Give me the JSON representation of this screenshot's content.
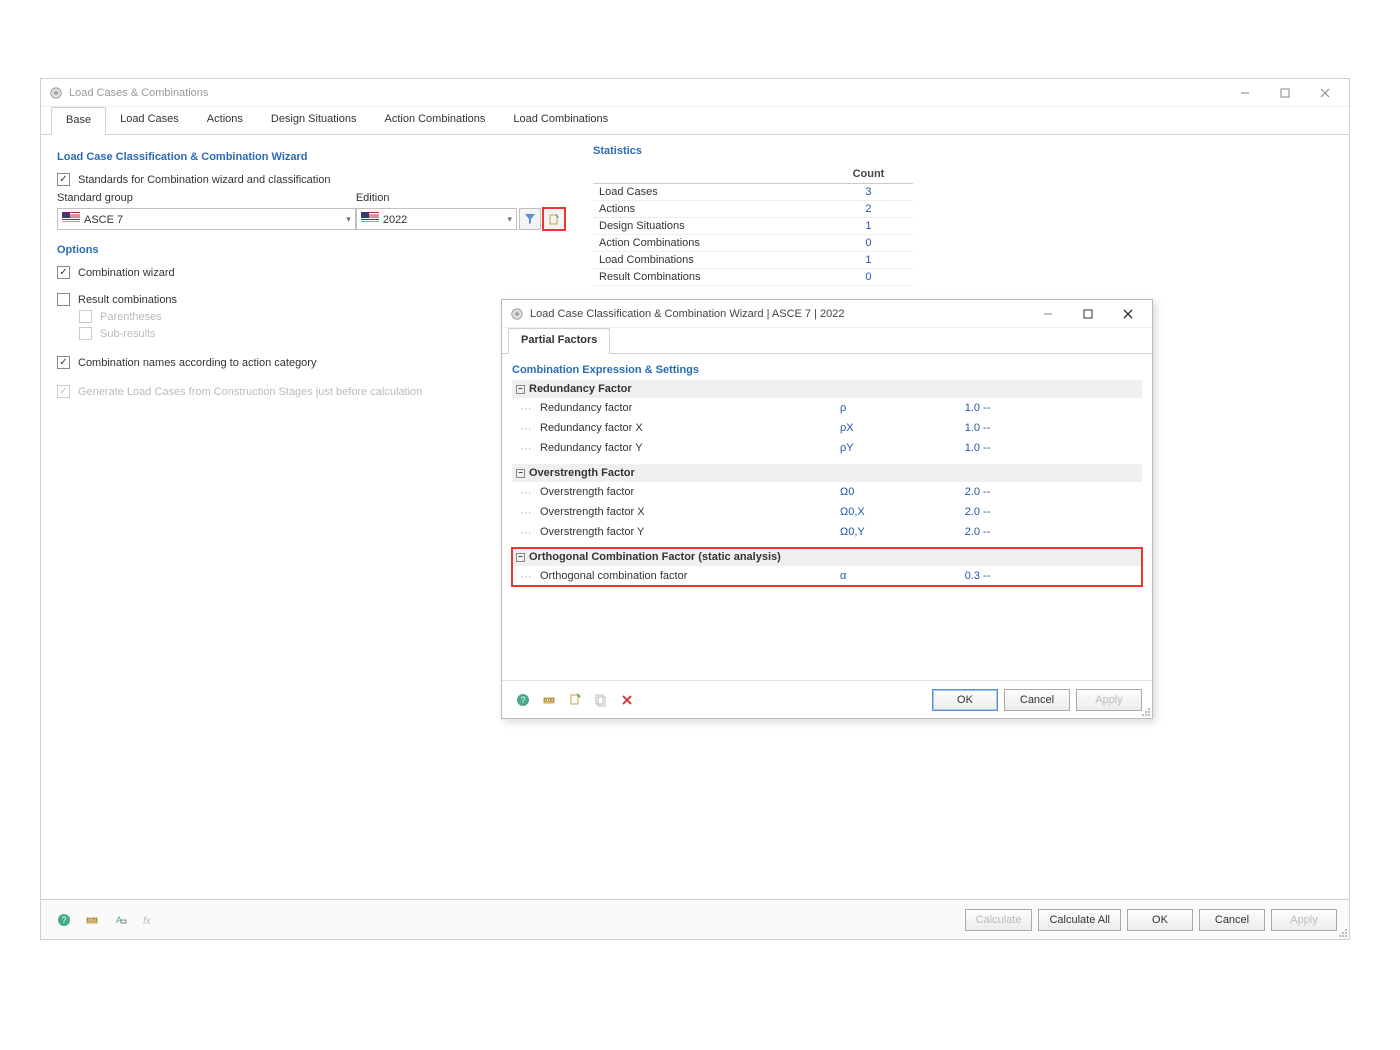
{
  "outer": {
    "title": "Load Cases & Combinations",
    "tabs": [
      "Base",
      "Load Cases",
      "Actions",
      "Design Situations",
      "Action Combinations",
      "Load Combinations"
    ],
    "activeTab": 0
  },
  "wizard": {
    "heading": "Load Case Classification & Combination Wizard",
    "standards_check_label": "Standards for Combination wizard and classification",
    "standard_group_label": "Standard group",
    "edition_label": "Edition",
    "standard_group_value": "ASCE 7",
    "edition_value": "2022",
    "options_heading": "Options",
    "opt_combo_wizard": "Combination wizard",
    "opt_result_combos": "Result combinations",
    "opt_parentheses": "Parentheses",
    "opt_subresults": "Sub-results",
    "opt_names_by_category": "Combination names according to action category",
    "opt_generate_from_stages": "Generate Load Cases from Construction Stages just before calculation"
  },
  "stats": {
    "heading": "Statistics",
    "count_header": "Count",
    "rows": [
      {
        "label": "Load Cases",
        "count": "3"
      },
      {
        "label": "Actions",
        "count": "2"
      },
      {
        "label": "Design Situations",
        "count": "1"
      },
      {
        "label": "Action Combinations",
        "count": "0"
      },
      {
        "label": "Load Combinations",
        "count": "1"
      },
      {
        "label": "Result Combinations",
        "count": "0"
      }
    ]
  },
  "inner": {
    "title": "Load Case Classification & Combination Wizard | ASCE 7 | 2022",
    "tab": "Partial Factors",
    "section_heading": "Combination Expression & Settings",
    "groups": [
      {
        "name": "Redundancy Factor",
        "params": [
          {
            "label": "Redundancy factor",
            "symbol": "ρ",
            "value": "1.0",
            "unit": "--"
          },
          {
            "label": "Redundancy factor X",
            "symbol": "ρX",
            "value": "1.0",
            "unit": "--"
          },
          {
            "label": "Redundancy factor Y",
            "symbol": "ρY",
            "value": "1.0",
            "unit": "--"
          }
        ],
        "highlighted": false
      },
      {
        "name": "Overstrength Factor",
        "params": [
          {
            "label": "Overstrength factor",
            "symbol": "Ω0",
            "value": "2.0",
            "unit": "--"
          },
          {
            "label": "Overstrength factor X",
            "symbol": "Ω0,X",
            "value": "2.0",
            "unit": "--"
          },
          {
            "label": "Overstrength factor Y",
            "symbol": "Ω0,Y",
            "value": "2.0",
            "unit": "--"
          }
        ],
        "highlighted": false
      },
      {
        "name": "Orthogonal Combination Factor (static analysis)",
        "params": [
          {
            "label": "Orthogonal combination factor",
            "symbol": "α",
            "value": "0.3",
            "unit": "--"
          }
        ],
        "highlighted": true
      }
    ],
    "buttons": {
      "ok": "OK",
      "cancel": "Cancel",
      "apply": "Apply"
    }
  },
  "footer": {
    "calculate": "Calculate",
    "calculate_all": "Calculate All",
    "ok": "OK",
    "cancel": "Cancel",
    "apply": "Apply"
  }
}
